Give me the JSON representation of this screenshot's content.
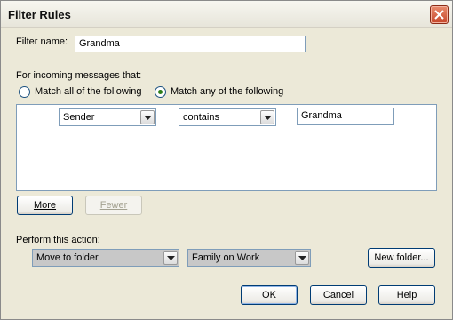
{
  "window": {
    "title": "Filter Rules"
  },
  "filter_name": {
    "label": "Filter name:",
    "value": "Grandma"
  },
  "conditions": {
    "heading": "For incoming messages that:",
    "match_all_label": "Match all of the following",
    "match_any_label": "Match any of the following",
    "selected": "match_any"
  },
  "rule": {
    "field": "Sender",
    "operator": "contains",
    "value": "Grandma"
  },
  "rule_buttons": {
    "more": "More",
    "fewer": "Fewer"
  },
  "action": {
    "label": "Perform this action:",
    "type": "Move to folder",
    "folder": "Family on Work",
    "new_folder": "New folder..."
  },
  "footer": {
    "ok": "OK",
    "cancel": "Cancel",
    "help": "Help"
  }
}
